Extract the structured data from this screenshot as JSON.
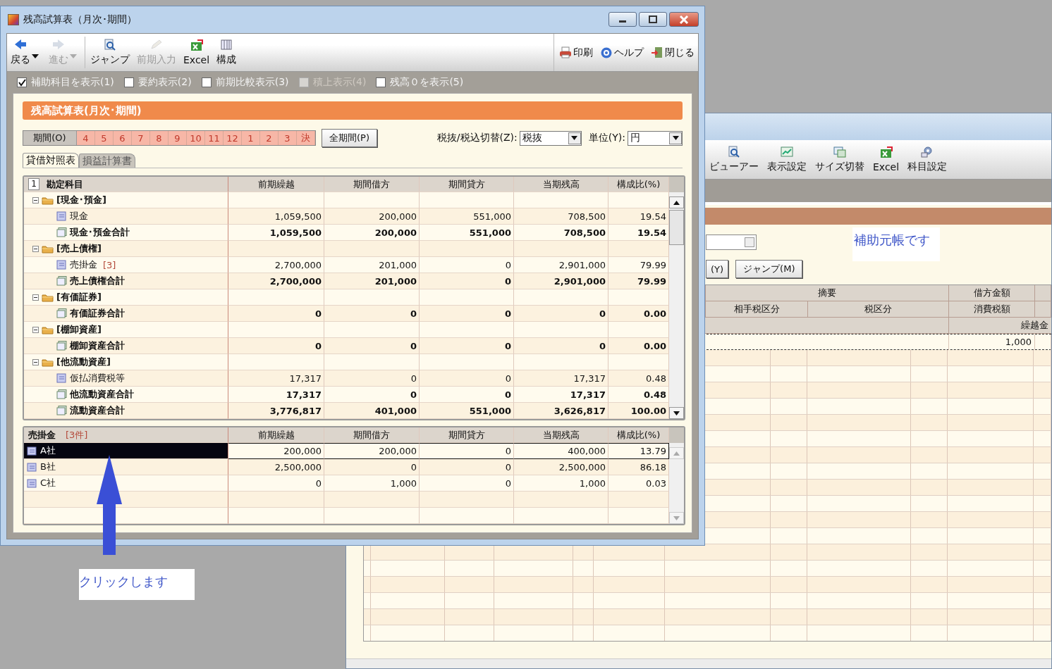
{
  "back_window": {
    "toolbar": [
      {
        "label": "ビューアー"
      },
      {
        "label": "表示設定"
      },
      {
        "label": "サイズ切替"
      },
      {
        "label": "Excel"
      },
      {
        "label": "科目設定"
      }
    ],
    "partial_button": "(Y)",
    "jump_button": "ジャンプ(M)",
    "note": "補助元帳です",
    "header_row_1": [
      "摘要",
      "借方金額"
    ],
    "header_row_2": [
      "相手税区分",
      "税区分",
      "消費税額"
    ],
    "header_row_3": "繰越金",
    "first_row_value": "1,000"
  },
  "main_window": {
    "title": "残高試算表（月次･期間）",
    "toolbar_left": [
      {
        "label": "戻る",
        "disabled": false,
        "dropdown": true
      },
      {
        "label": "進む",
        "disabled": true,
        "dropdown": true
      },
      {
        "label": "ジャンプ",
        "disabled": false,
        "dropdown": false
      },
      {
        "label": "前期入力",
        "disabled": true,
        "dropdown": false
      },
      {
        "label": "Excel",
        "disabled": false,
        "dropdown": false
      },
      {
        "label": "構成",
        "disabled": false,
        "dropdown": false
      }
    ],
    "toolbar_right": [
      {
        "label": "印刷"
      },
      {
        "label": "ヘルプ"
      },
      {
        "label": "閉じる"
      }
    ],
    "options": [
      {
        "label": "補助科目を表示(1)",
        "checked": true,
        "disabled": false
      },
      {
        "label": "要約表示(2)",
        "checked": false,
        "disabled": false
      },
      {
        "label": "前期比較表示(3)",
        "checked": false,
        "disabled": false
      },
      {
        "label": "積上表示(4)",
        "checked": false,
        "disabled": true
      },
      {
        "label": "残高０を表示(5)",
        "checked": false,
        "disabled": false
      }
    ],
    "heading": "残高試算表(月次･期間)",
    "period_button": "期間(O)",
    "periods": [
      {
        "label": "4",
        "selected": true
      },
      {
        "label": "5",
        "selected": true
      },
      {
        "label": "6",
        "selected": true
      },
      {
        "label": "7",
        "selected": true
      },
      {
        "label": "8",
        "selected": true
      },
      {
        "label": "9",
        "selected": true
      },
      {
        "label": "10",
        "selected": true
      },
      {
        "label": "11",
        "selected": true
      },
      {
        "label": "12",
        "selected": true
      },
      {
        "label": "1",
        "selected": true
      },
      {
        "label": "2",
        "selected": true
      },
      {
        "label": "3",
        "selected": true
      },
      {
        "label": "決",
        "selected": true
      }
    ],
    "all_periods_button": "全期間(P)",
    "tax_label": "税抜/税込切替(Z):",
    "tax_value": "税抜",
    "unit_label": "単位(Y):",
    "unit_value": "円",
    "tabs": [
      {
        "label": "貸借対照表",
        "selected": true
      },
      {
        "label": "損益計算書",
        "selected": false
      }
    ],
    "table": {
      "row_number": "1",
      "columns": [
        "勘定科目",
        "前期繰越",
        "期間借方",
        "期間貸方",
        "当期残高",
        "構成比(%)"
      ],
      "rows": [
        {
          "kind": "group",
          "account": "[現金･預金]"
        },
        {
          "kind": "item",
          "account": "現金",
          "values": [
            "1,059,500",
            "200,000",
            "551,000",
            "708,500",
            "19.54"
          ]
        },
        {
          "kind": "total",
          "account": "現金･預金合計",
          "values": [
            "1,059,500",
            "200,000",
            "551,000",
            "708,500",
            "19.54"
          ]
        },
        {
          "kind": "group",
          "account": "[売上債権]"
        },
        {
          "kind": "item",
          "account": "売掛金",
          "count": "[3]",
          "values": [
            "2,700,000",
            "201,000",
            "0",
            "2,901,000",
            "79.99"
          ]
        },
        {
          "kind": "total",
          "account": "売上債権合計",
          "values": [
            "2,700,000",
            "201,000",
            "0",
            "2,901,000",
            "79.99"
          ]
        },
        {
          "kind": "group",
          "account": "[有価証券]"
        },
        {
          "kind": "total",
          "account": "有価証券合計",
          "values": [
            "0",
            "0",
            "0",
            "0",
            "0.00"
          ]
        },
        {
          "kind": "group",
          "account": "[棚卸資産]"
        },
        {
          "kind": "total",
          "account": "棚卸資産合計",
          "values": [
            "0",
            "0",
            "0",
            "0",
            "0.00"
          ]
        },
        {
          "kind": "group",
          "account": "[他流動資産]"
        },
        {
          "kind": "item",
          "account": "仮払消費税等",
          "values": [
            "17,317",
            "0",
            "0",
            "17,317",
            "0.48"
          ]
        },
        {
          "kind": "total",
          "account": "他流動資産合計",
          "values": [
            "17,317",
            "0",
            "0",
            "17,317",
            "0.48"
          ]
        },
        {
          "kind": "total",
          "account": "流動資産合計",
          "values": [
            "3,776,817",
            "401,000",
            "551,000",
            "3,626,817",
            "100.00"
          ]
        }
      ]
    },
    "detail_table": {
      "title": "売掛金",
      "count": "[3件]",
      "columns": [
        "前期繰越",
        "期間借方",
        "期間貸方",
        "当期残高",
        "構成比(%)"
      ],
      "rows": [
        {
          "name": "A社",
          "selected": true,
          "values": [
            "200,000",
            "200,000",
            "0",
            "400,000",
            "13.79"
          ]
        },
        {
          "name": "B社",
          "selected": false,
          "values": [
            "2,500,000",
            "0",
            "0",
            "2,500,000",
            "86.18"
          ]
        },
        {
          "name": "C社",
          "selected": false,
          "values": [
            "0",
            "1,000",
            "0",
            "1,000",
            "0.03"
          ]
        }
      ]
    }
  },
  "annotation": {
    "label": "クリックします"
  }
}
